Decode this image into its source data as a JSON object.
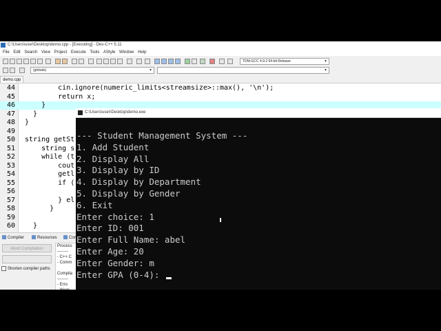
{
  "window": {
    "title": "C:\\Users\\user\\Desktop\\demo.cpp - [Executing] - Dev-C++ 5.11"
  },
  "menu": [
    "File",
    "Edit",
    "Search",
    "View",
    "Project",
    "Execute",
    "Tools",
    "AStyle",
    "Window",
    "Help"
  ],
  "toolbar": {
    "compiler": "TDM-GCC 4.9.2 64-bit Release",
    "scope": "(globals)"
  },
  "editor": {
    "file_tab": "demo.cpp",
    "lines": [
      {
        "n": "44",
        "text": "        cin.ignore(numeric_limits<streamsize>::max(), '\\n');"
      },
      {
        "n": "45",
        "text": "        return x;"
      },
      {
        "n": "46",
        "text": "    }"
      },
      {
        "n": "47",
        "text": "  }"
      },
      {
        "n": "48",
        "text": "}"
      },
      {
        "n": "49",
        "text": ""
      },
      {
        "n": "50",
        "text": "string getSt"
      },
      {
        "n": "51",
        "text": "    string s"
      },
      {
        "n": "52",
        "text": "    while (t"
      },
      {
        "n": "53",
        "text": "        cout"
      },
      {
        "n": "54",
        "text": "        getl"
      },
      {
        "n": "55",
        "text": "        if ("
      },
      {
        "n": "56",
        "text": ""
      },
      {
        "n": "57",
        "text": "        } el"
      },
      {
        "n": "58",
        "text": "      }"
      },
      {
        "n": "59",
        "text": ""
      },
      {
        "n": "60",
        "text": "  }"
      }
    ]
  },
  "bottom_panel": {
    "tabs": [
      "Compiler",
      "Resources",
      "Compi"
    ],
    "abort_label": "Abort Compilation",
    "shorten_label": "Shorten compiler paths",
    "log_lines": [
      "Process",
      "--------",
      "- C++ C",
      "- Comm",
      "",
      "Compila",
      "--------",
      "- Erro",
      "- Warn"
    ]
  },
  "console": {
    "title": "C:\\Users\\user\\Desktop\\demo.exe",
    "lines": [
      "--- Student Management System ---",
      "1. Add Student",
      "2. Display All",
      "3. Display by ID",
      "4. Display by Department",
      "5. Display by Gender",
      "6. Exit",
      "Enter choice: 1",
      "Enter ID: 001",
      "Enter Full Name: abel",
      "Enter Age: 20",
      "Enter Gender: m",
      "Enter GPA (0-4): "
    ]
  }
}
